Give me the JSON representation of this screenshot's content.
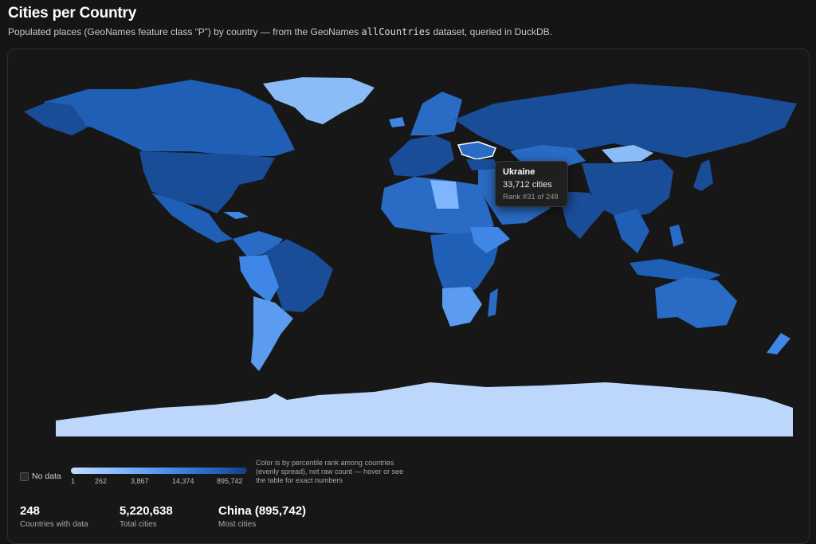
{
  "header": {
    "title": "Cities per Country",
    "subtitle_before": "Populated places (GeoNames feature class “P”) by country — from the GeoNames ",
    "subtitle_code": "allCountries",
    "subtitle_after": " dataset, queried in DuckDB."
  },
  "tooltip": {
    "country": "Ukraine",
    "cities": "33,712 cities",
    "rank": "Rank #31 of 248"
  },
  "legend": {
    "no_data_label": "No data",
    "ticks": [
      "1",
      "262",
      "3,867",
      "14,374",
      "895,742"
    ],
    "note": "Color is by percentile rank among countries (evenly spread), not raw count — hover or see the table for exact numbers"
  },
  "stats": [
    {
      "value": "248",
      "label": "Countries with data"
    },
    {
      "value": "5,220,638",
      "label": "Total cities"
    },
    {
      "value": "China (895,742)",
      "label": "Most cities"
    }
  ],
  "colors": {
    "background": "#151515",
    "darkest": "#143d82",
    "dark": "#1f5fb5",
    "mid": "#3f86e6",
    "light": "#7fb4ff",
    "lightest": "#c5ddfd",
    "highlight_outline": "#ffffff"
  }
}
